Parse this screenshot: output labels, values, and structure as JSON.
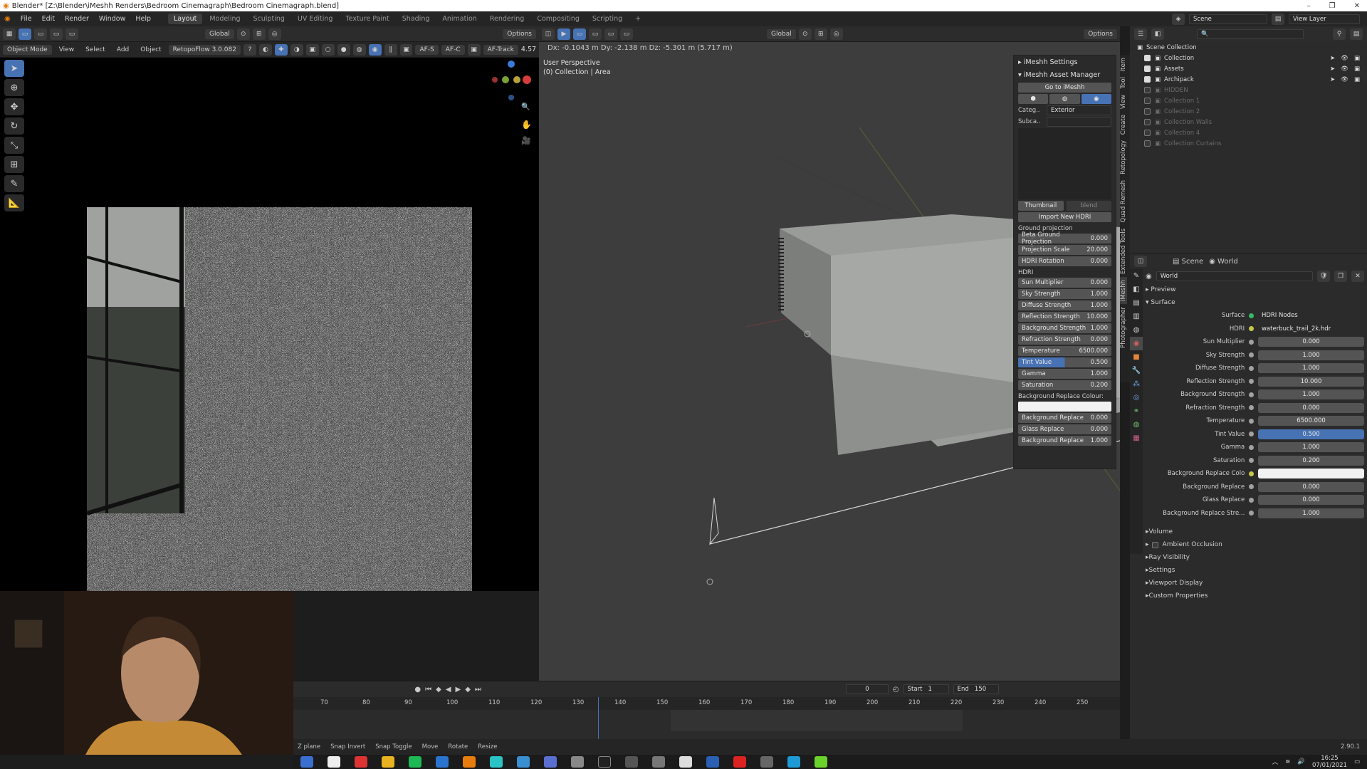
{
  "window": {
    "title": "Blender* [Z:\\Blender\\iMeshh Renders\\Bedroom Cinemagraph\\Bedroom Cinemagraph.blend]",
    "controls": [
      "–",
      "❐",
      "✕"
    ]
  },
  "menubar": {
    "items": [
      "File",
      "Edit",
      "Render",
      "Window",
      "Help"
    ],
    "workspaces": [
      "Layout",
      "Modeling",
      "Sculpting",
      "UV Editing",
      "Texture Paint",
      "Shading",
      "Animation",
      "Rendering",
      "Compositing",
      "Scripting"
    ],
    "active_workspace": "Layout",
    "scene_label": "Scene",
    "view_layer_label": "View Layer"
  },
  "left_header": {
    "mode": "Object Mode",
    "menus": [
      "View",
      "Select",
      "Add",
      "Object"
    ],
    "addon": "RetopoFlow 3.0.082",
    "orientation": "Global",
    "options": "Options",
    "af_s": "AF-S",
    "af_c": "AF-C",
    "af_track": "AF-Track",
    "value": "4.57"
  },
  "viewport": {
    "header_info": "Dx: -0.1043 m  Dy: -2.138 m  Dz: -5.301 m (5.717 m)",
    "orientation": "Global",
    "options": "Options",
    "perspective": "User Perspective",
    "collection": "(0) Collection | Area"
  },
  "npanel": {
    "settings_title": "iMeshh Settings",
    "asset_manager_title": "iMeshh Asset Manager",
    "go_button": "Go to iMeshh",
    "category_label": "Categ..",
    "category_value": "Exterior",
    "subcategory_label": "Subca..",
    "thumbnail_label": "Thumbnail",
    "blend_label": "blend",
    "import_button": "Import New HDRI",
    "ground_projection_label": "Ground projection",
    "ground_fields": [
      {
        "label": "Beta Ground Projection",
        "value": "0.000"
      },
      {
        "label": "Projection Scale",
        "value": "20.000"
      },
      {
        "label": "HDRI Rotation",
        "value": "0.000"
      }
    ],
    "hdri_label": "HDRI",
    "hdri_fields": [
      {
        "label": "Sun Multiplier",
        "value": "0.000"
      },
      {
        "label": "Sky Strength",
        "value": "1.000"
      },
      {
        "label": "Diffuse Strength",
        "value": "1.000"
      },
      {
        "label": "Reflection Strength",
        "value": "10.000"
      },
      {
        "label": "Background Strength",
        "value": "1.000"
      },
      {
        "label": "Refraction Strength",
        "value": "0.000"
      },
      {
        "label": "Temperature",
        "value": "6500.000"
      },
      {
        "label": "Tint Value",
        "value": "0.500"
      },
      {
        "label": "Gamma",
        "value": "1.000"
      },
      {
        "label": "Saturation",
        "value": "0.200"
      }
    ],
    "bg_replace_colour_label": "Background Replace Colour:",
    "bottom_fields": [
      {
        "label": "Background Replace",
        "value": "0.000"
      },
      {
        "label": "Glass Replace",
        "value": "0.000"
      },
      {
        "label": "Background Replace",
        "value": "1.000"
      }
    ],
    "vertical_tabs": [
      "Item",
      "Tool",
      "View",
      "Create",
      "Retopology",
      "Quad Remesh",
      "Extended Tools",
      "iMeshh",
      "Photographer"
    ]
  },
  "timeline": {
    "current_frame": "0",
    "start_label": "Start",
    "start": "1",
    "end_label": "End",
    "end": "150",
    "ticks": [
      "70",
      "80",
      "90",
      "100",
      "110",
      "120",
      "130",
      "140",
      "150",
      "160",
      "170",
      "180",
      "190",
      "200",
      "210",
      "220",
      "230",
      "240",
      "250"
    ]
  },
  "statusbar": {
    "items": [
      "Z plane",
      "Snap Invert",
      "Snap Toggle",
      "Move",
      "Rotate",
      "Resize"
    ],
    "version": "2.90.1"
  },
  "outliner": {
    "root": "Scene Collection",
    "items": [
      {
        "label": "Collection",
        "dim": false
      },
      {
        "label": "Assets",
        "dim": false
      },
      {
        "label": "Archipack",
        "dim": false
      },
      {
        "label": "HIDDEN",
        "dim": true
      },
      {
        "label": "Collection 1",
        "dim": true
      },
      {
        "label": "Collection 2",
        "dim": true
      },
      {
        "label": "Collection Walls",
        "dim": true
      },
      {
        "label": "Collection 4",
        "dim": true
      },
      {
        "label": "Collection Curtains",
        "dim": true
      }
    ]
  },
  "properties": {
    "scene_tab": "Scene",
    "world_tab": "World",
    "world_name": "World",
    "preview_label": "Preview",
    "surface_section": "Surface",
    "surface_label": "Surface",
    "surface_value": "HDRI Nodes",
    "hdri_label": "HDRI",
    "hdri_value": "waterbuck_trail_2k.hdr",
    "rows": [
      {
        "label": "Sun Multiplier",
        "value": "0.000"
      },
      {
        "label": "Sky Strength",
        "value": "1.000"
      },
      {
        "label": "Diffuse Strength",
        "value": "1.000"
      },
      {
        "label": "Reflection Strength",
        "value": "10.000"
      },
      {
        "label": "Background Strength",
        "value": "1.000"
      },
      {
        "label": "Refraction Strength",
        "value": "0.000"
      },
      {
        "label": "Temperature",
        "value": "6500.000"
      },
      {
        "label": "Tint Value",
        "value": "0.500"
      },
      {
        "label": "Gamma",
        "value": "1.000"
      },
      {
        "label": "Saturation",
        "value": "0.200"
      }
    ],
    "bg_replace_colo_label": "Background Replace Colo",
    "rows2": [
      {
        "label": "Background Replace",
        "value": "0.000"
      },
      {
        "label": "Glass Replace",
        "value": "0.000"
      },
      {
        "label": "Background Replace Stre...",
        "value": "1.000"
      }
    ],
    "sections": [
      "Volume",
      "Ambient Occlusion",
      "Ray Visibility",
      "Settings",
      "Viewport Display",
      "Custom Properties"
    ]
  },
  "taskbar": {
    "time": "16:25",
    "date": "07/01/2021"
  },
  "colors": {
    "accent": "#4772b3",
    "panel": "#2b2b2b",
    "viewport": "#3d3d3d",
    "field": "#545454"
  }
}
